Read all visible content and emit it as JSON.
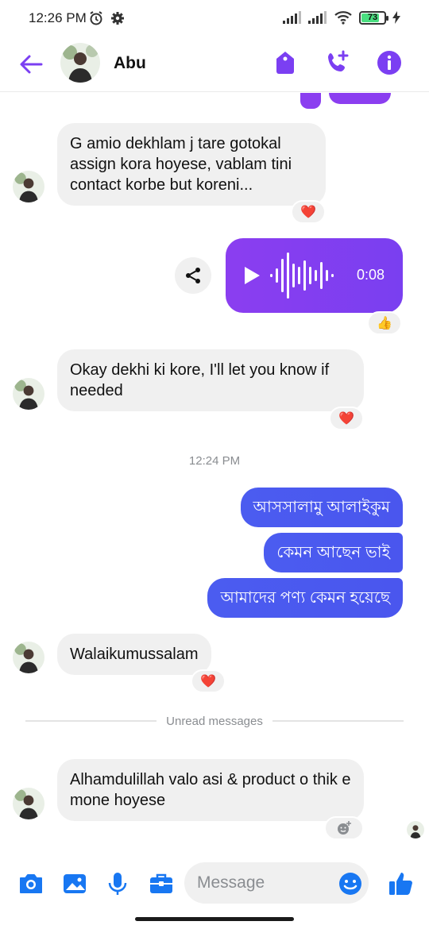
{
  "status_bar": {
    "time": "12:26 PM",
    "battery": "73"
  },
  "header": {
    "contact_name": "Abu"
  },
  "messages": {
    "m1": {
      "text": "G amio dekhlam j tare gotokal assign kora hoyese, vablam tini contact korbe but koreni...",
      "reaction": "❤️"
    },
    "voice": {
      "duration": "0:08",
      "reaction": "👍"
    },
    "m2": {
      "text": "Okay dekhi ki kore, I'll let you know if needed",
      "reaction": "❤️"
    },
    "timestamp": "12:24 PM",
    "out1": "আসসালামু আলাইকুম",
    "out2": "কেমন আছেন ভাই",
    "out3": "আমাদের পণ্য কেমন হয়েছে",
    "m3": {
      "text": "Walaikumussalam",
      "reaction": "❤️"
    },
    "unread_label": "Unread messages",
    "m4": {
      "text": "Alhamdulillah valo asi & product o thik e mone hoyese"
    }
  },
  "composer": {
    "placeholder": "Message"
  },
  "colors": {
    "accent": "#7b3ff2",
    "outgoing": "#4b5cf0",
    "incoming": "#f0f0f0",
    "blue_icons": "#1877f2"
  },
  "icons": [
    "back-arrow-icon",
    "tag-icon",
    "video-call-icon",
    "info-icon",
    "share-icon",
    "play-icon",
    "camera-icon",
    "gallery-icon",
    "microphone-icon",
    "briefcase-icon",
    "emoji-icon",
    "thumbs-up-icon",
    "add-reaction-icon"
  ]
}
